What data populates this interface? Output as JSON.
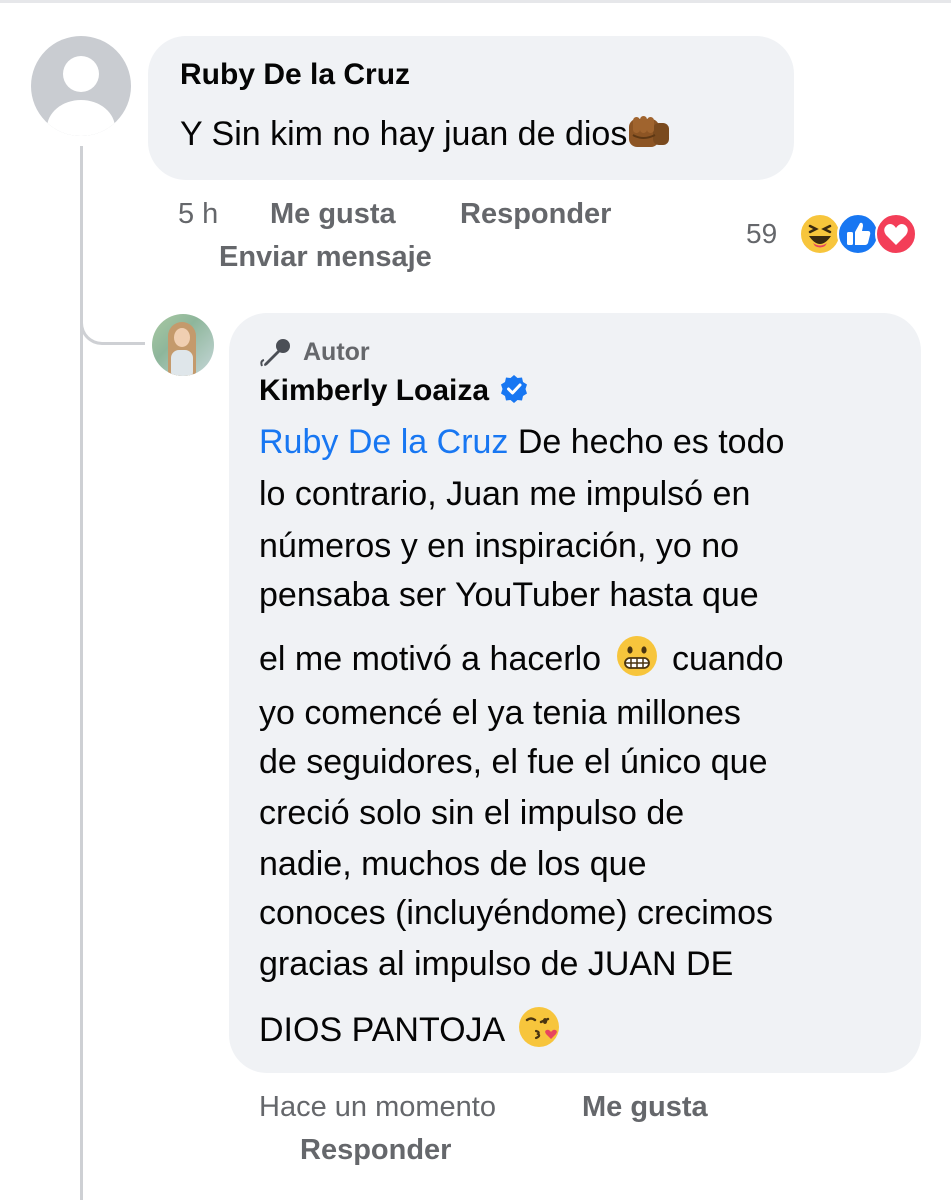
{
  "comment": {
    "author": "Ruby De la Cruz",
    "text": "Y Sin kim no hay juan de dios",
    "emoji": "oncoming-fist-icon",
    "time": "5 h",
    "like_label": "Me gusta",
    "reply_label": "Responder",
    "message_label": "Enviar mensaje",
    "reaction_count": "59",
    "reactions": [
      "haha-reaction-icon",
      "like-reaction-icon",
      "love-reaction-icon"
    ]
  },
  "reply": {
    "badge_label": "Autor",
    "badge_icon": "microphone-icon",
    "author": "Kimberly Loaiza",
    "verified_icon": "verified-badge-icon",
    "mention": "Ruby De la Cruz",
    "lines": [
      " De hecho es todo",
      "lo contrario, Juan me impulsó en",
      "números y en inspiración, yo no",
      "pensaba ser YouTuber hasta que",
      "el me motivó a hacerlo",
      "cuando",
      "yo comencé el ya tenia millones",
      "de seguidores, el fue el único que",
      "creció solo sin el impulso de",
      "nadie, muchos de los que",
      "conoces (incluyéndome) crecimos",
      "gracias al impulso de JUAN DE",
      "DIOS PANTOJA"
    ],
    "emoji_grimace": "grimacing-face-icon",
    "emoji_kiss": "face-blowing-kiss-icon",
    "time": "Hace un momento",
    "like_label": "Me gusta",
    "reply_label": "Responder"
  },
  "colors": {
    "bubble": "#f0f2f5",
    "meta_text": "#65676b",
    "mention": "#1877f2",
    "thread_line": "#ced0d4"
  }
}
